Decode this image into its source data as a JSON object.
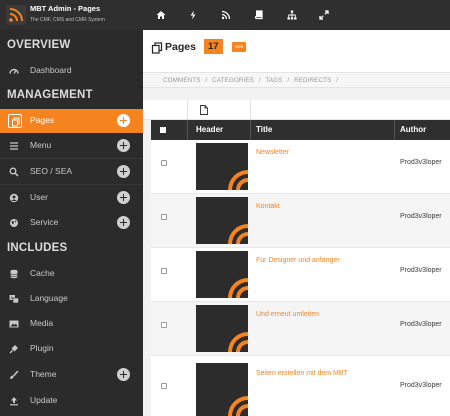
{
  "app": {
    "title": "MBT Admin - Pages",
    "subtitle": "The CMF, CMS and CMR System"
  },
  "topbar": {
    "icons": [
      "home-icon",
      "bolt-icon",
      "rss-icon",
      "book-icon",
      "sitemap-icon",
      "expand-icon"
    ]
  },
  "sidebar": {
    "sections": {
      "overview": "OVERVIEW",
      "management": "MANAGEMENT",
      "includes": "INCLUDES"
    },
    "items": {
      "dashboard": "Dashboard",
      "pages": "Pages",
      "menu": "Menu",
      "seo": "SEO / SEA",
      "user": "User",
      "service": "Service",
      "cache": "Cache",
      "language": "Language",
      "media": "Media",
      "plugin": "Plugin",
      "theme": "Theme",
      "update": "Update"
    }
  },
  "page": {
    "title": "Pages",
    "count": "17",
    "new_badge": "new"
  },
  "subnav": {
    "links": [
      "COMMENTS",
      "/",
      "CATEGORIES",
      "/",
      "TAGS",
      "/",
      "REDIRECTS",
      "/"
    ]
  },
  "table": {
    "headers": {
      "header": "Header",
      "title": "Title",
      "author": "Author"
    },
    "rows": [
      {
        "title": "Newsletter",
        "author": "Prod3v3loper"
      },
      {
        "title": "Kontakt",
        "author": "Prod3v3loper"
      },
      {
        "title": "Für Designer und anfänger",
        "author": "Prod3v3loper"
      },
      {
        "title": "Und erneut umleiten",
        "author": "Prod3v3loper"
      },
      {
        "title": "Seiten erstellen mit dem MBT",
        "author": "Prod3v3loper"
      }
    ]
  },
  "colors": {
    "accent": "#f5831f",
    "sidebar_bg": "#2b2b2b",
    "topbar_bg": "#2f2f2f"
  }
}
